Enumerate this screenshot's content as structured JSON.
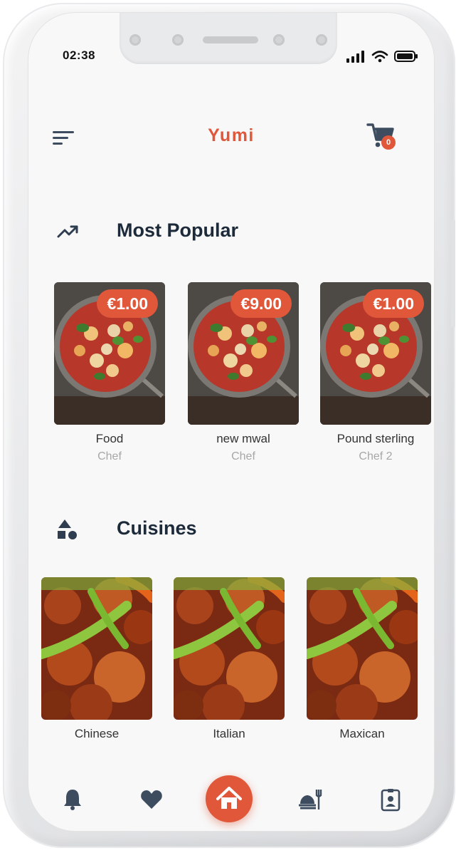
{
  "status": {
    "time": "02:38"
  },
  "header": {
    "title": "Yumi",
    "cart_count": "0"
  },
  "most_popular": {
    "title": "Most Popular",
    "items": [
      {
        "price": "€1.00",
        "name": "Food",
        "chef": "Chef"
      },
      {
        "price": "€9.00",
        "name": "new mwal",
        "chef": "Chef"
      },
      {
        "price": "€1.00",
        "name": "Pound sterling",
        "chef": "Chef 2"
      }
    ]
  },
  "cuisines": {
    "title": "Cuisines",
    "items": [
      {
        "name": "Chinese"
      },
      {
        "name": "Italian"
      },
      {
        "name": "Maxican"
      }
    ]
  },
  "colors": {
    "accent": "#e0573a",
    "heading": "#1c2a3a",
    "icon": "#3d4d5f",
    "muted": "#a7a7a7"
  },
  "nav": {
    "icons": [
      "bell-icon",
      "heart-icon",
      "home-icon",
      "restaurant-icon",
      "profile-icon"
    ],
    "active": "home-icon"
  }
}
